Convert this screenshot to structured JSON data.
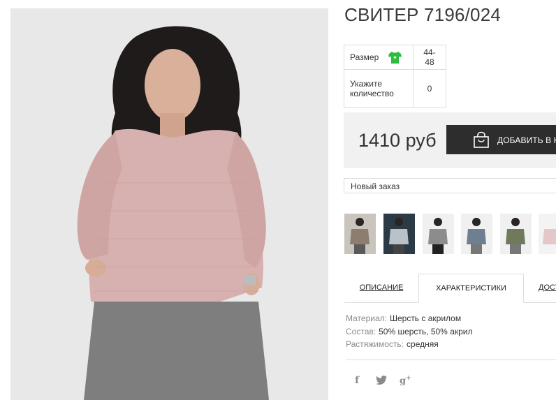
{
  "product": {
    "title": "СВИТЕР 7196/024",
    "image_alt": "Женщина в розовом вязаном свитере"
  },
  "options": {
    "size_label": "Размер",
    "size_value": "44-48",
    "qty_label": "Укажите количество",
    "qty_value": "0",
    "size_icon": "green-tshirt-icon"
  },
  "buy": {
    "price": "1410 руб",
    "add_to_cart": "ДОБАВИТЬ В КОРЗИНУ",
    "bag_icon": "shopping-bag-icon"
  },
  "order_select": {
    "value": "Новый заказ"
  },
  "thumbnails": [
    {
      "color": "#8d7d6e"
    },
    {
      "color": "#b8c2c8"
    },
    {
      "color": "#8c8c8c"
    },
    {
      "color": "#6f7f92"
    },
    {
      "color": "#6f7a5c"
    },
    {
      "color": "#e4c7c6"
    }
  ],
  "tabs": [
    {
      "label": "ОПИСАНИЕ"
    },
    {
      "label": "ХАРАКТЕРИСТИКИ"
    },
    {
      "label": "ДОСТАВКА"
    }
  ],
  "specs": [
    {
      "key": "Материал:",
      "value": "Шерсть с акрилом"
    },
    {
      "key": "Состав:",
      "value": "50% шерсть, 50% акрил"
    },
    {
      "key": "Растяжимость:",
      "value": "средняя"
    }
  ],
  "social": [
    {
      "icon": "facebook-icon",
      "glyph": "f"
    },
    {
      "icon": "twitter-icon",
      "glyph": "🐦"
    },
    {
      "icon": "google-plus-icon",
      "glyph": "g+"
    }
  ],
  "colors": {
    "accent_dark": "#2d2d2d",
    "price_box": "#f1f1f1",
    "tee_green": "#2bbd3c",
    "sweater": "#d7b1b0"
  }
}
